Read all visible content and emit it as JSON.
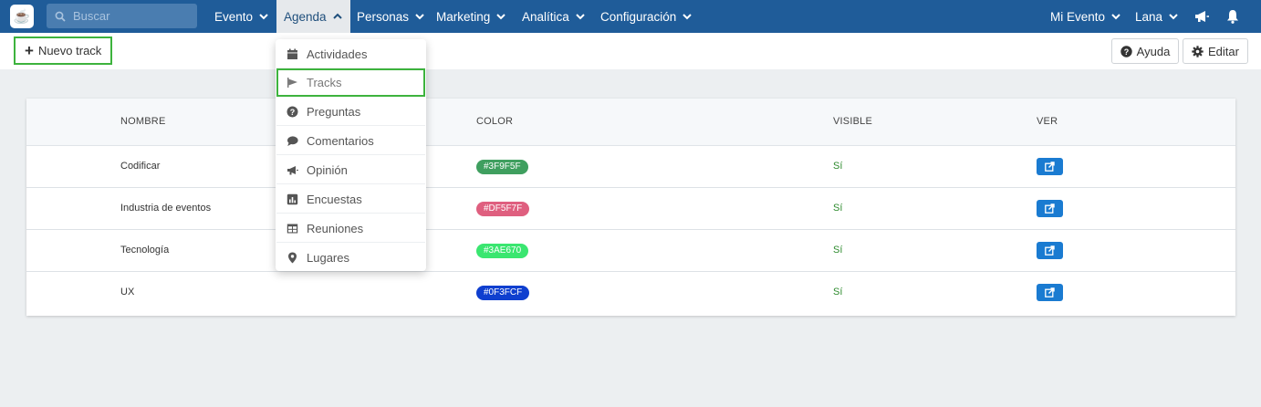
{
  "nav": {
    "search_placeholder": "Buscar",
    "menus": [
      "Evento",
      "Agenda",
      "Personas",
      "Marketing",
      "Analítica",
      "Configuración"
    ],
    "right": [
      "Mi Evento",
      "Lana"
    ]
  },
  "toolbar": {
    "new_label": "Nuevo track",
    "help_label": "Ayuda",
    "edit_label": "Editar"
  },
  "dropdown": {
    "items": [
      "Actividades",
      "Tracks",
      "Preguntas",
      "Comentarios",
      "Opinión",
      "Encuestas",
      "Reuniones",
      "Lugares"
    ]
  },
  "table": {
    "headers": [
      "NOMBRE",
      "COLOR",
      "VISIBLE",
      "VER"
    ],
    "rows": [
      {
        "name": "Codificar",
        "color": "#3F9F5F",
        "visible": "Sí"
      },
      {
        "name": "Industria de eventos",
        "color": "#DF5F7F",
        "visible": "Sí"
      },
      {
        "name": "Tecnología",
        "color": "#3AE670",
        "visible": "Sí"
      },
      {
        "name": "UX",
        "color": "#0F3FCF",
        "visible": "Sí"
      }
    ]
  },
  "colors": {
    "nav_bg": "#1f5c99",
    "highlight": "#3db33d",
    "view_button": "#1a7bd1",
    "visible_text": "#2e8b2e"
  }
}
